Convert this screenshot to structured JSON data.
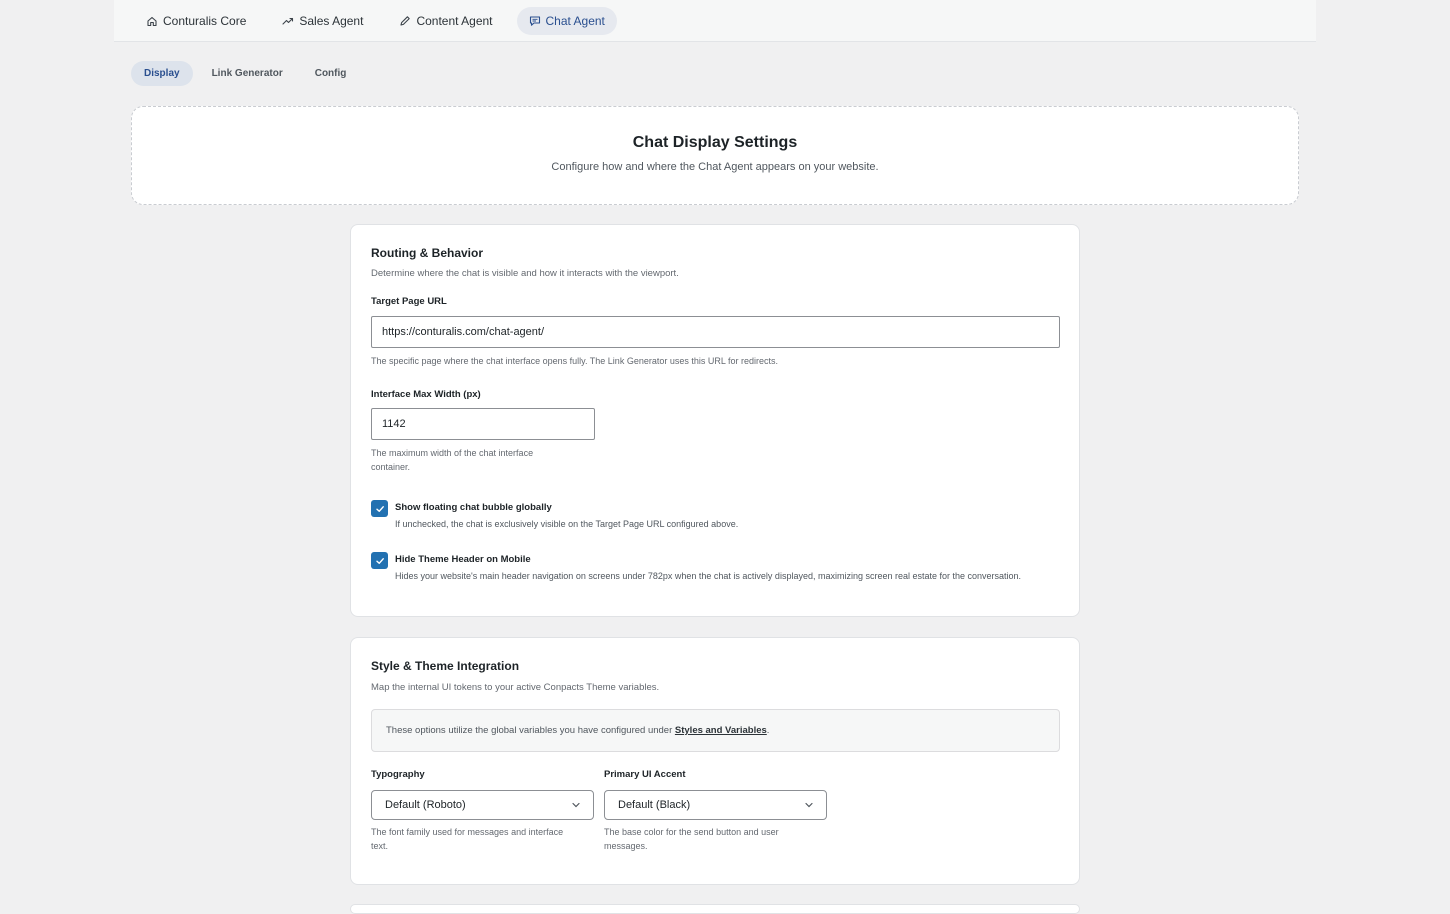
{
  "top_tabs": [
    {
      "label": "Conturalis Core",
      "icon": "home-icon",
      "active": false
    },
    {
      "label": "Sales Agent",
      "icon": "trend-icon",
      "active": false
    },
    {
      "label": "Content Agent",
      "icon": "pencil-icon",
      "active": false
    },
    {
      "label": "Chat Agent",
      "icon": "chat-icon",
      "active": true
    }
  ],
  "sub_tabs": [
    {
      "label": "Display",
      "active": true
    },
    {
      "label": "Link Generator",
      "active": false
    },
    {
      "label": "Config",
      "active": false
    }
  ],
  "hero": {
    "title": "Chat Display Settings",
    "subtitle": "Configure how and where the Chat Agent appears on your website."
  },
  "routing": {
    "title": "Routing & Behavior",
    "description": "Determine where the chat is visible and how it interacts with the viewport.",
    "target_url": {
      "label": "Target Page URL",
      "value": "https://conturalis.com/chat-agent/",
      "help": "The specific page where the chat interface opens fully. The Link Generator uses this URL for redirects."
    },
    "max_width": {
      "label": "Interface Max Width (px)",
      "value": "1142",
      "help_line1": "The maximum width of the chat interface",
      "help_line2": "container."
    },
    "floating_bubble": {
      "label": "Show floating chat bubble globally",
      "checked": true,
      "help": "If unchecked, the chat is exclusively visible on the Target Page URL configured above."
    },
    "hide_header": {
      "label": "Hide Theme Header on Mobile",
      "checked": true,
      "help": "Hides your website's main header navigation on screens under 782px when the chat is actively displayed, maximizing screen real estate for the conversation."
    }
  },
  "style": {
    "title": "Style & Theme Integration",
    "description": "Map the internal UI tokens to your active Conpacts Theme variables.",
    "notice_text": "These options utilize the global variables you have configured under ",
    "notice_link": "Styles and Variables",
    "notice_end": ".",
    "typography": {
      "label": "Typography",
      "value": "Default (Roboto)",
      "help_line1": "The font family used for messages and interface",
      "help_line2": "text."
    },
    "accent": {
      "label": "Primary UI Accent",
      "value": "Default (Black)",
      "help_line1": "The base color for the send button and user",
      "help_line2": "messages."
    }
  },
  "colors": {
    "accent": "#2271b1",
    "active_tab": "#2a4f8f"
  }
}
